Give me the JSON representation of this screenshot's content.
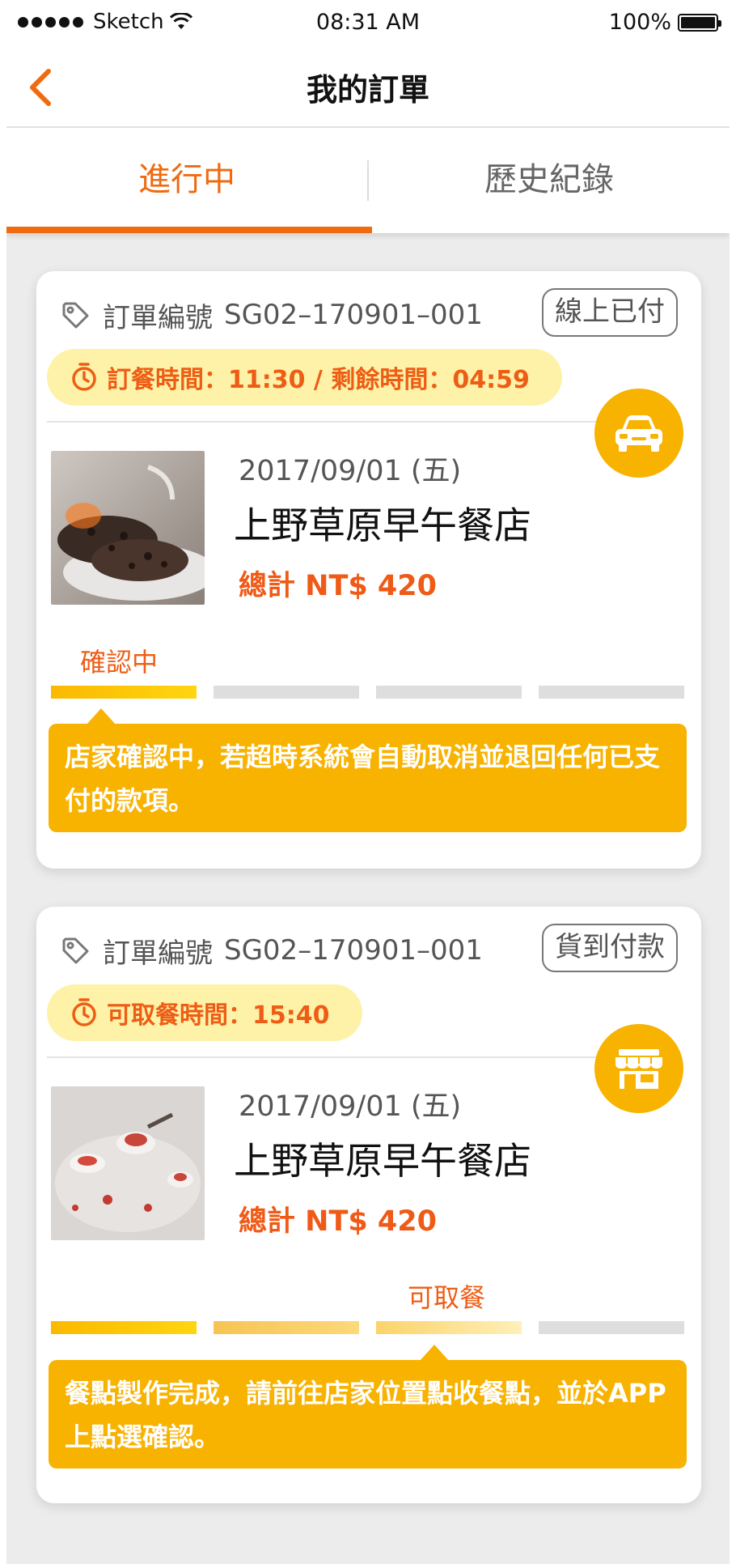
{
  "status_bar": {
    "carrier": "Sketch",
    "time": "08:31 AM",
    "battery": "100%"
  },
  "nav": {
    "title": "我的訂單"
  },
  "tabs": [
    {
      "label": "進行中",
      "active": true
    },
    {
      "label": "歷史紀錄",
      "active": false
    }
  ],
  "colors": {
    "accent": "#f06a10",
    "yellow": "#f8b200",
    "pill": "#fdf2a8",
    "text_orange": "#ee5d15"
  },
  "orders": [
    {
      "order_label": "訂單編號",
      "order_id": "SG02–170901–001",
      "payment": "線上已付",
      "time_text": "訂餐時間：11:30 / 剩餘時間：04:59",
      "mode_icon": "car-icon",
      "date": "2017/09/01 (五)",
      "store": "上野草原早午餐店",
      "total": "總計 NT$ 420",
      "stage": "確認中",
      "progress_segments": 1,
      "message": "店家確認中，若超時系統會自動取消並退回任何已支付的款項。"
    },
    {
      "order_label": "訂單編號",
      "order_id": "SG02–170901–001",
      "payment": "貨到付款",
      "time_text": "可取餐時間：15:40",
      "mode_icon": "store-icon",
      "date": "2017/09/01 (五)",
      "store": "上野草原早午餐店",
      "total": "總計 NT$ 420",
      "stage": "可取餐",
      "progress_segments": 3,
      "message": "餐點製作完成，請前往店家位置點收餐點，並於APP上點選確認。"
    }
  ]
}
